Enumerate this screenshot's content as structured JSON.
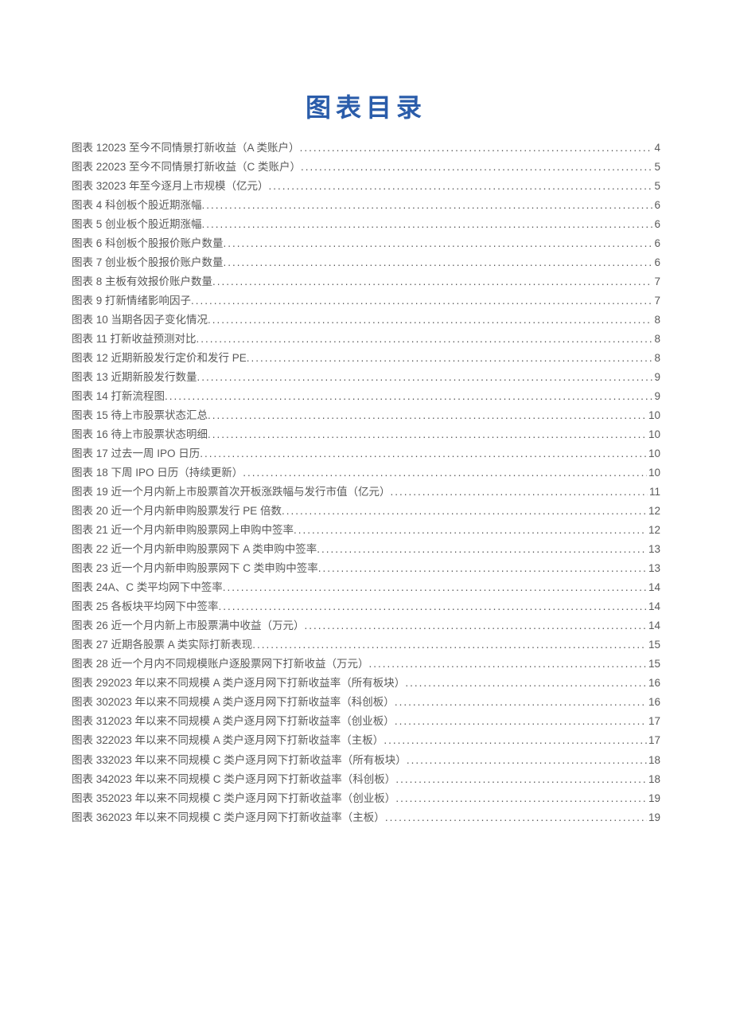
{
  "title": "图表目录",
  "entries": [
    {
      "label": "图表 12023 至今不同情景打新收益（A 类账户）",
      "page": "4"
    },
    {
      "label": "图表 22023 至今不同情景打新收益（C 类账户）",
      "page": "5"
    },
    {
      "label": "图表 32023 年至今逐月上市规模（亿元）",
      "page": "5"
    },
    {
      "label": "图表 4 科创板个股近期涨幅",
      "page": "6"
    },
    {
      "label": "图表 5 创业板个股近期涨幅",
      "page": "6"
    },
    {
      "label": "图表 6 科创板个股报价账户数量",
      "page": "6"
    },
    {
      "label": "图表 7 创业板个股报价账户数量",
      "page": "6"
    },
    {
      "label": "图表 8 主板有效报价账户数量",
      "page": "7"
    },
    {
      "label": "图表 9 打新情绪影响因子",
      "page": "7"
    },
    {
      "label": "图表 10 当期各因子变化情况",
      "page": "8"
    },
    {
      "label": "图表 11 打新收益预测对比",
      "page": "8"
    },
    {
      "label": "图表 12 近期新股发行定价和发行 PE",
      "page": "8"
    },
    {
      "label": "图表 13 近期新股发行数量",
      "page": "9"
    },
    {
      "label": "图表 14 打新流程图",
      "page": "9"
    },
    {
      "label": "图表 15 待上市股票状态汇总",
      "page": "10"
    },
    {
      "label": "图表 16 待上市股票状态明细",
      "page": "10"
    },
    {
      "label": "图表 17 过去一周 IPO 日历",
      "page": "10"
    },
    {
      "label": "图表 18 下周 IPO 日历（持续更新）",
      "page": "10"
    },
    {
      "label": "图表 19 近一个月内新上市股票首次开板涨跌幅与发行市值（亿元）",
      "page": "11"
    },
    {
      "label": "图表 20 近一个月内新申购股票发行 PE 倍数",
      "page": "12"
    },
    {
      "label": "图表 21 近一个月内新申购股票网上申购中签率",
      "page": "12"
    },
    {
      "label": "图表 22 近一个月内新申购股票网下 A 类申购中签率",
      "page": "13"
    },
    {
      "label": "图表 23 近一个月内新申购股票网下 C 类申购中签率",
      "page": "13"
    },
    {
      "label": "图表 24A、C 类平均网下中签率",
      "page": "14"
    },
    {
      "label": "图表 25 各板块平均网下中签率",
      "page": "14"
    },
    {
      "label": "图表 26 近一个月内新上市股票满中收益（万元）",
      "page": "14"
    },
    {
      "label": "图表 27 近期各股票 A 类实际打新表现",
      "page": "15"
    },
    {
      "label": "图表 28 近一个月内不同规模账户逐股票网下打新收益（万元）",
      "page": "15"
    },
    {
      "label": "图表 292023 年以来不同规模 A 类户逐月网下打新收益率（所有板块）",
      "page": "16"
    },
    {
      "label": "图表 302023 年以来不同规模 A 类户逐月网下打新收益率（科创板）",
      "page": "16"
    },
    {
      "label": "图表 312023 年以来不同规模 A 类户逐月网下打新收益率（创业板）",
      "page": "17"
    },
    {
      "label": "图表 322023 年以来不同规模 A 类户逐月网下打新收益率（主板）",
      "page": "17"
    },
    {
      "label": "图表 332023 年以来不同规模 C 类户逐月网下打新收益率（所有板块）",
      "page": "18"
    },
    {
      "label": "图表 342023 年以来不同规模 C 类户逐月网下打新收益率（科创板）",
      "page": "18"
    },
    {
      "label": "图表 352023 年以来不同规模 C 类户逐月网下打新收益率（创业板）",
      "page": "19"
    },
    {
      "label": "图表 362023 年以来不同规模 C 类户逐月网下打新收益率（主板）",
      "page": "19"
    }
  ]
}
